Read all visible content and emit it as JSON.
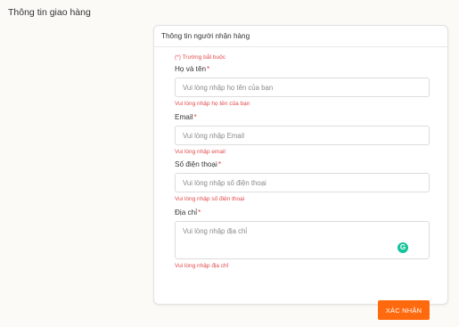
{
  "page": {
    "title": "Thông tin giao hàng"
  },
  "form": {
    "header": "Thông tin người nhận hàng",
    "required_note": "(*) Trường bắt buộc",
    "required_marker": "*",
    "fields": [
      {
        "label": "Họ và tên",
        "placeholder": "Vui lòng nhập họ tên của bạn",
        "value": "",
        "error": "Vui lòng nhập họ tên của bạn"
      },
      {
        "label": "Email",
        "placeholder": "Vui lòng nhập Email",
        "value": "",
        "error": "Vui lòng nhập email"
      },
      {
        "label": "Số điện thoại",
        "placeholder": "Vui lòng nhập số điện thoại",
        "value": "",
        "error": "Vui lòng nhập số điện thoại"
      },
      {
        "label": "Địa chỉ",
        "placeholder": "Vui lòng nhập địa chỉ",
        "value": "",
        "error": "Vui lòng nhập địa chỉ"
      }
    ],
    "grammarly_icon": "G",
    "submit_label": "XÁC NHẬN"
  },
  "colors": {
    "accent": "#ff6a0f",
    "error": "#e24a4a",
    "grammarly": "#15c39a"
  },
  "icons": {
    "grammarly": "grammarly-icon"
  }
}
